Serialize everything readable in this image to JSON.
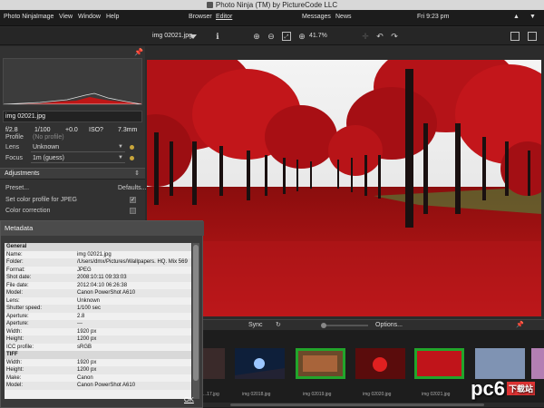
{
  "app": {
    "title": "Photo Ninja (TM) by PictureCode LLC"
  },
  "menu": {
    "items": [
      "Photo Ninja",
      "Image",
      "View",
      "Window",
      "Help"
    ],
    "modes": [
      "Browser",
      "Editor"
    ],
    "right": [
      "Messages",
      "News"
    ],
    "clock": "Fri 9:23 pm"
  },
  "toolbar": {
    "filename": "img 02021.jpg",
    "zoom": "41.7%"
  },
  "left": {
    "image_name": "img 02021.jpg",
    "exif": [
      "f/2.8",
      "1/100",
      "+0.0",
      "ISO?",
      "7.3mm"
    ],
    "profile_label": "Profile",
    "profile_value": "(No profile)",
    "lens_label": "Lens",
    "lens_value": "Unknown",
    "focus_label": "Focus",
    "focus_value": "1m (guess)",
    "adjustments": "Adjustments",
    "preset": "Preset...",
    "defaults": "Defaults...",
    "set_profile": "Set color profile for JPEG",
    "color_correction": "Color correction"
  },
  "metadata": {
    "title": "Metadata",
    "rows": [
      {
        "k": "General",
        "v": "",
        "group": true
      },
      {
        "k": "Name:",
        "v": "img 02021.jpg"
      },
      {
        "k": "Folder:",
        "v": "/Users/dmx/Pictures/Wallpapers. HQ. Mix 569"
      },
      {
        "k": "Format:",
        "v": "JPEG"
      },
      {
        "k": "Shot date:",
        "v": "2008:10:11 09:33:03"
      },
      {
        "k": "File date:",
        "v": "2012:04:10 06:26:38"
      },
      {
        "k": "Model:",
        "v": "Canon PowerShot A610"
      },
      {
        "k": "Lens:",
        "v": "Unknown"
      },
      {
        "k": "Shutter speed:",
        "v": "1/100 sec"
      },
      {
        "k": "Aperture:",
        "v": "2.8"
      },
      {
        "k": "Aperture:",
        "v": "---"
      },
      {
        "k": "Width:",
        "v": "1920 px"
      },
      {
        "k": "Height:",
        "v": "1200 px"
      },
      {
        "k": "ICC profile:",
        "v": "sRGB"
      },
      {
        "k": "TIFF",
        "v": "",
        "group": true
      },
      {
        "k": "Width:",
        "v": "1920 px"
      },
      {
        "k": "Height:",
        "v": "1200 px"
      },
      {
        "k": "Make:",
        "v": "Canon"
      },
      {
        "k": "Model:",
        "v": "Canon PowerShot A610"
      }
    ],
    "ok": "OK"
  },
  "filmbar": {
    "sync": "Sync",
    "options": "Options..."
  },
  "filmstrip": {
    "labels": [
      "...17.jpg",
      "img 02018.jpg",
      "img 02019.jpg",
      "img 02020.jpg",
      "img 02021.jpg"
    ]
  },
  "watermark": {
    "text": "pc6",
    "badge": "下载站"
  },
  "colors": {
    "accent_green": "#22a52b",
    "photo_red": "#c0141a"
  }
}
